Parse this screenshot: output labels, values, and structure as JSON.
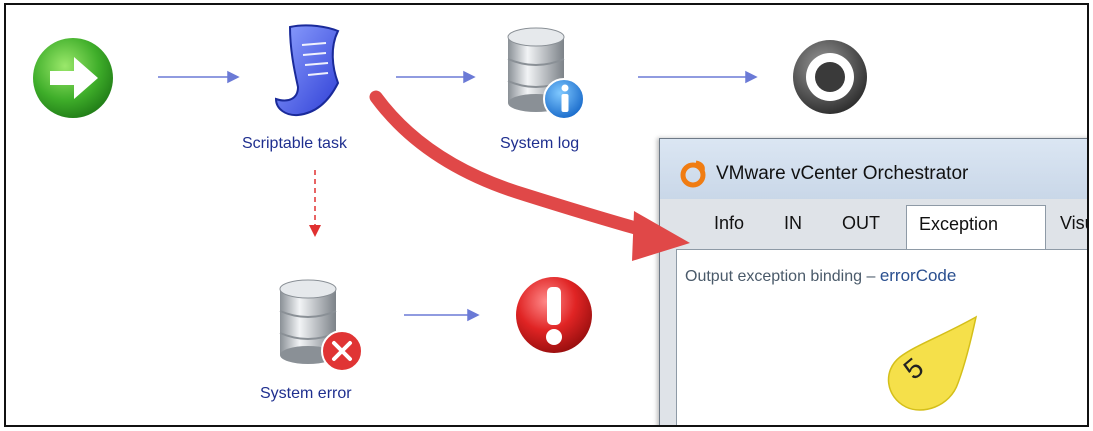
{
  "workflow": {
    "nodes": [
      {
        "label": ""
      },
      {
        "label": "Scriptable task"
      },
      {
        "label": "System log"
      },
      {
        "label": ""
      },
      {
        "label": "System error"
      },
      {
        "label": ""
      }
    ]
  },
  "dialog": {
    "title": "VMware vCenter Orchestrator",
    "tabs": [
      "Info",
      "IN",
      "OUT",
      "Exception",
      "Visu"
    ],
    "active_tab": "Exception",
    "binding_label": "Output exception binding –",
    "binding_value": "errorCode"
  },
  "callout": {
    "number": "5"
  },
  "colors": {
    "flow_arrow": "#6b7ad6",
    "error_arrow": "#e03030",
    "big_arrow": "#e04848",
    "callout": "#f5e04a",
    "label": "#1f2f8f"
  },
  "icons": [
    "start-arrow-icon",
    "script-scroll-icon",
    "database-info-icon",
    "end-target-icon",
    "database-error-icon",
    "exception-icon",
    "orchestrator-logo-icon"
  ]
}
